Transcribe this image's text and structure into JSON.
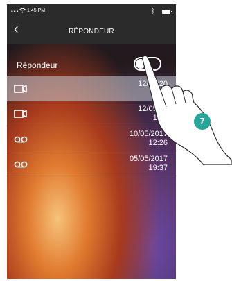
{
  "status_bar": {
    "signal": "•••",
    "wifi_icon": "wifi-icon",
    "time": "1:45 PM",
    "bluetooth_icon": "bluetooth-icon",
    "battery_icon": "battery-icon"
  },
  "nav": {
    "back_icon": "chevron-left-icon",
    "title": "RÉPONDEUR"
  },
  "toggle": {
    "label": "Répondeur",
    "state": "on"
  },
  "messages": [
    {
      "type": "video",
      "icon": "video-camera-icon",
      "date": "12/05/20",
      "time": "1:"
    },
    {
      "type": "video",
      "icon": "video-camera-icon",
      "date": "12/05/20",
      "time": "14:3"
    },
    {
      "type": "audio",
      "icon": "voicemail-icon",
      "date": "10/05/2017",
      "time": "12:26"
    },
    {
      "type": "audio",
      "icon": "voicemail-icon",
      "date": "05/05/2017",
      "time": "19:37"
    }
  ],
  "callout": {
    "number": "7"
  },
  "colors": {
    "bars": "#2b2b2b",
    "selected_row": "#c8cdd7",
    "callout": "#26a69a"
  }
}
